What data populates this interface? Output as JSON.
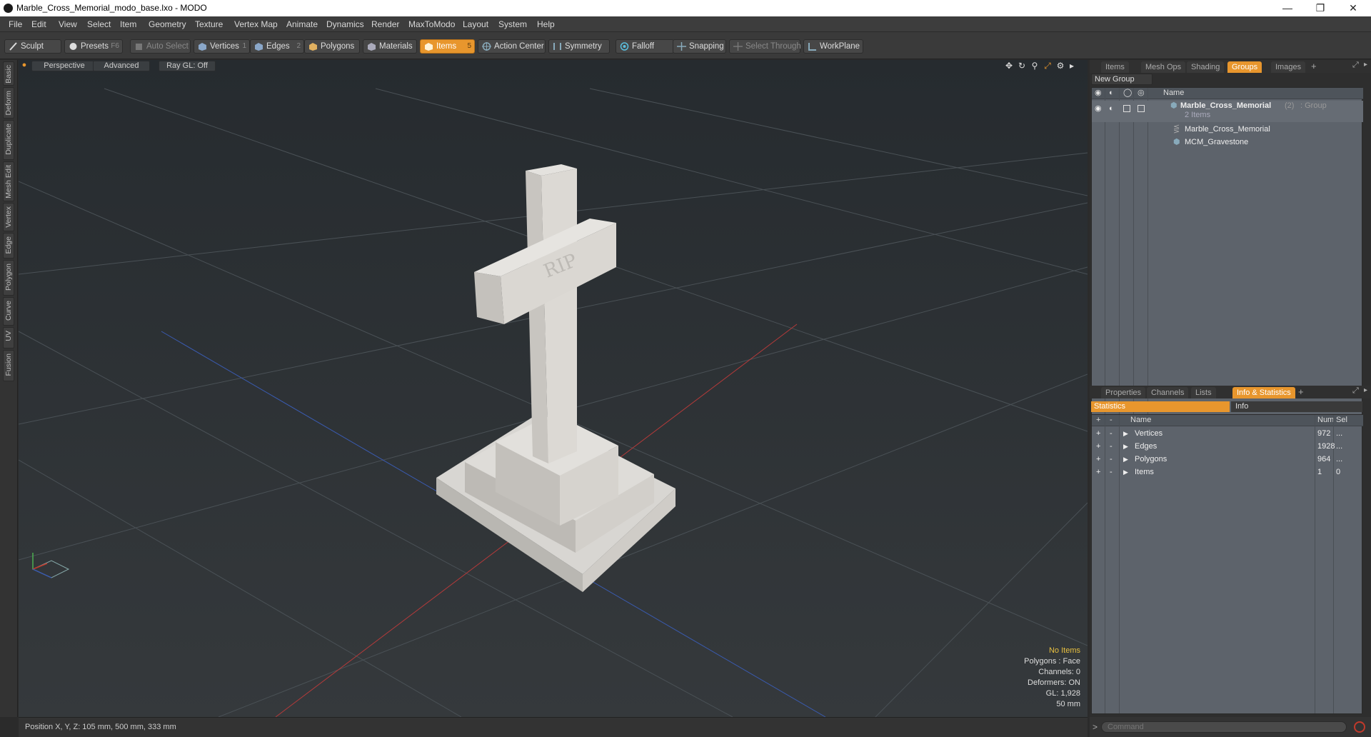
{
  "window": {
    "title": "Marble_Cross_Memorial_modo_base.lxo - MODO"
  },
  "menu": [
    "File",
    "Edit",
    "View",
    "Select",
    "Item",
    "Geometry",
    "Texture",
    "Vertex Map",
    "Animate",
    "Dynamics",
    "Render",
    "MaxToModo",
    "Layout",
    "System",
    "Help"
  ],
  "toolbar": {
    "sculpt": "Sculpt",
    "presets": "Presets",
    "presets_key": "F6",
    "auto_select": "Auto Select",
    "vertices": "Vertices",
    "vertices_key": "1",
    "edges": "Edges",
    "edges_key": "2",
    "polygons": "Polygons",
    "materials": "Materials",
    "items": "Items",
    "items_key": "5",
    "action_center": "Action Center",
    "symmetry": "Symmetry",
    "falloff": "Falloff",
    "snapping": "Snapping",
    "select_through": "Select Through",
    "workplane": "WorkPlane"
  },
  "left_tabs": [
    "Basic",
    "Deform",
    "Duplicate",
    "Mesh Edit",
    "Vertex",
    "Edge",
    "Polygon",
    "Curve",
    "UV",
    "Fusion"
  ],
  "viewport": {
    "perspective": "Perspective",
    "advanced": "Advanced",
    "raygl": "Ray GL: Off",
    "engraving": "RIP",
    "info": {
      "no_items": "No Items",
      "polygons": "Polygons : Face",
      "channels": "Channels: 0",
      "deformers": "Deformers: ON",
      "gl": "GL: 1,928",
      "scale": "50 mm"
    }
  },
  "statusbar": {
    "position": "Position X, Y, Z:  105 mm, 500 mm, 333 mm"
  },
  "groups_panel": {
    "tabs": [
      "Items",
      "Mesh Ops",
      "Shading",
      "Groups",
      "Images"
    ],
    "active_tab": "Groups",
    "new_group": "New Group",
    "col_name": "Name",
    "group_name": "Marble_Cross_Memorial",
    "group_count": "(2)",
    "group_type": ": Group",
    "group_sub": "2 Items",
    "children": [
      "Marble_Cross_Memorial",
      "MCM_Gravestone"
    ]
  },
  "info_panel": {
    "tabs": [
      "Properties",
      "Channels",
      "Lists",
      "Info & Statistics"
    ],
    "active_tab": "Info & Statistics",
    "stats_tab": "Statistics",
    "info_tab": "Info",
    "col_name": "Name",
    "col_num": "Num",
    "col_sel": "Sel",
    "rows": [
      {
        "name": "Vertices",
        "num": "972",
        "sel": "..."
      },
      {
        "name": "Edges",
        "num": "1928",
        "sel": "..."
      },
      {
        "name": "Polygons",
        "num": "964",
        "sel": "..."
      },
      {
        "name": "Items",
        "num": "1",
        "sel": "0"
      }
    ]
  },
  "command": {
    "placeholder": "Command"
  },
  "colors": {
    "accent": "#e8962d",
    "panel": "#5d636b"
  }
}
